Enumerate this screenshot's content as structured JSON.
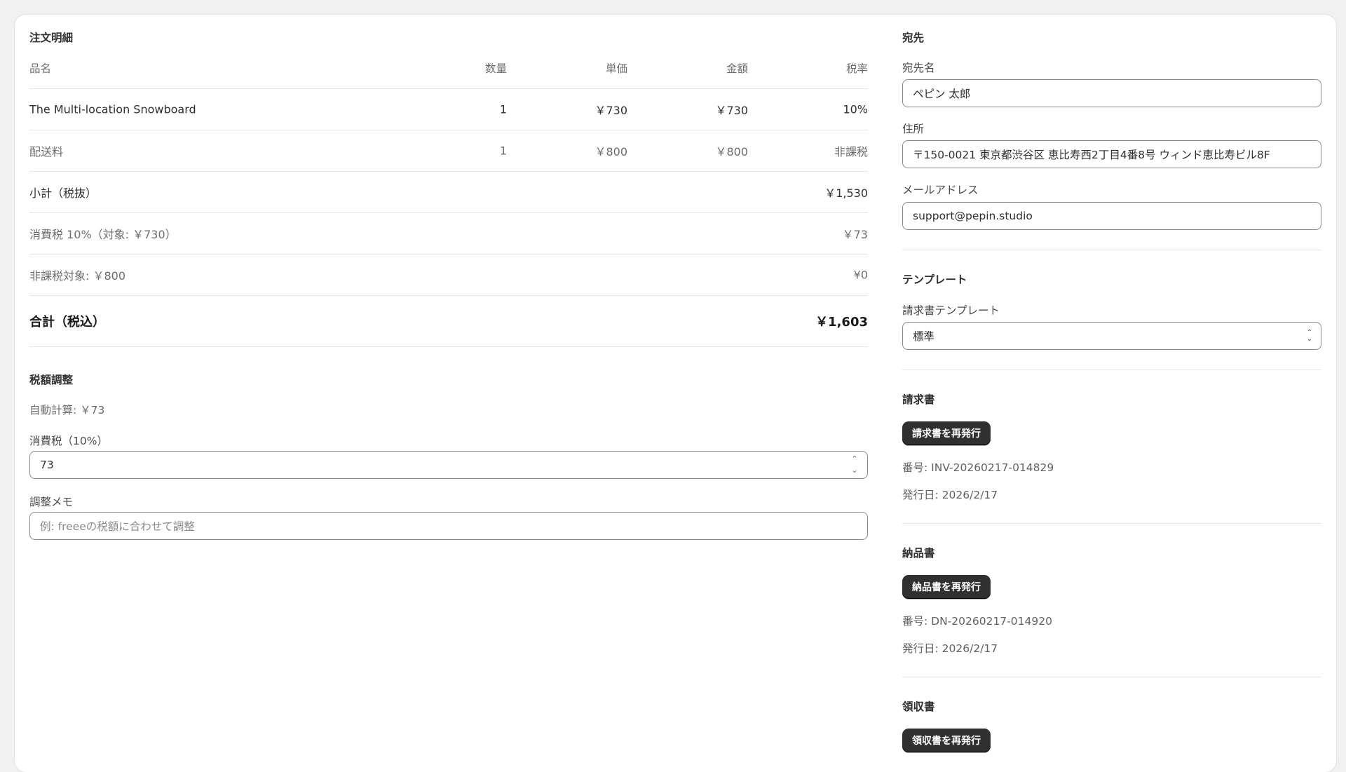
{
  "order": {
    "title": "注文明細",
    "headers": {
      "name": "品名",
      "qty": "数量",
      "price": "単価",
      "amount": "金額",
      "tax": "税率"
    },
    "items": [
      {
        "name": "The Multi-location Snowboard",
        "qty": "1",
        "price": "￥730",
        "amount": "￥730",
        "tax": "10%"
      },
      {
        "name": "配送料",
        "qty": "1",
        "price": "￥800",
        "amount": "￥800",
        "tax": "非課税"
      }
    ],
    "subtotal": {
      "label": "小計（税抜）",
      "value": "￥1,530"
    },
    "consumption_tax": {
      "label": "消費税 10%（対象: ￥730）",
      "value": "￥73"
    },
    "non_taxable": {
      "label": "非課税対象: ￥800",
      "value": "¥0"
    },
    "total": {
      "label": "合計（税込）",
      "value": "￥1,603"
    }
  },
  "tax_adjust": {
    "title": "税額調整",
    "auto_calc": "自動計算: ￥73",
    "tax_label": "消費税（10%）",
    "tax_value": "73",
    "memo_label": "調整メモ",
    "memo_placeholder": "例: freeeの税額に合わせて調整"
  },
  "recipient": {
    "title": "宛先",
    "name_label": "宛先名",
    "name_value": "ペピン 太郎",
    "address_label": "住所",
    "address_value": "〒150-0021 東京都渋谷区 恵比寿西2丁目4番8号 ウィンド恵比寿ビル8F",
    "email_label": "メールアドレス",
    "email_value": "support@pepin.studio"
  },
  "template": {
    "title": "テンプレート",
    "select_label": "請求書テンプレート",
    "selected": "標準"
  },
  "invoice": {
    "title": "請求書",
    "button": "請求書を再発行",
    "number": "番号: INV-20260217-014829",
    "date": "発行日: 2026/2/17"
  },
  "delivery_note": {
    "title": "納品書",
    "button": "納品書を再発行",
    "number": "番号: DN-20260217-014920",
    "date": "発行日: 2026/2/17"
  },
  "receipt": {
    "title": "領収書",
    "button": "領収書を再発行"
  }
}
